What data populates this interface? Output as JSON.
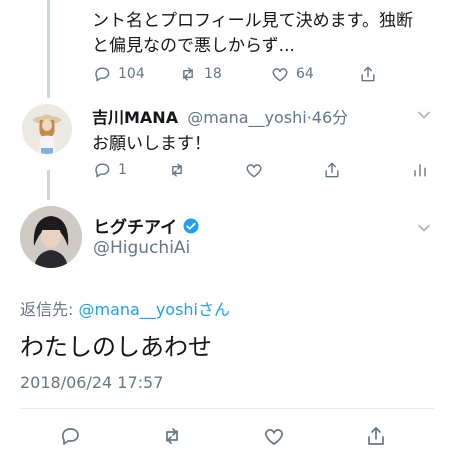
{
  "tweet1": {
    "text_lines": [
      "ント名とプロフィール見て決めます。独断",
      "と偏見なので悪しからず..."
    ],
    "actions": {
      "reply": "104",
      "retweet": "18",
      "like": "64"
    }
  },
  "tweet2": {
    "display_name": "吉川MANA",
    "handle": "@mana__yoshi",
    "separator": "·",
    "time": "46分",
    "text": "お願いします！",
    "actions": {
      "reply": "1"
    }
  },
  "main_tweet": {
    "display_name": "ヒグチアイ",
    "handle": "@HiguchiAi",
    "reply_to_prefix": "返信先: ",
    "reply_to_handle": "@mana__yoshi",
    "reply_to_suffix": "さん",
    "text": "わたしのしあわせ",
    "timestamp": "2018/06/24 17:57"
  },
  "icons": {
    "reply": "reply-icon",
    "retweet": "retweet-icon",
    "like": "heart-icon",
    "share": "share-icon",
    "analytics": "analytics-icon",
    "verified": "verified-badge-icon",
    "chevron": "chevron-down-icon"
  },
  "colors": {
    "link_blue": "#1da1f2",
    "muted": "#657786",
    "thread_line": "#ccd6dd"
  }
}
